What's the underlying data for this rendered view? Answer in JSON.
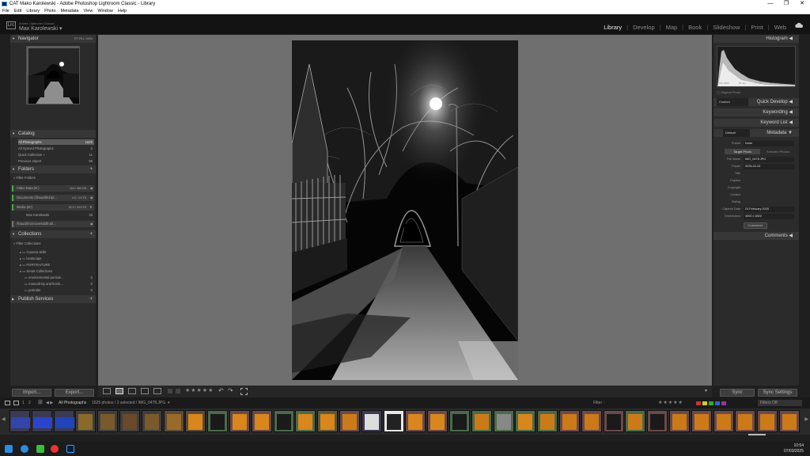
{
  "window": {
    "title": "CAT Mako Karolewski - Adobe Photoshop Lightroom Classic - Library",
    "controls": {
      "minimize": "—",
      "maximize": "❐",
      "close": "✕"
    }
  },
  "menu": [
    "File",
    "Edit",
    "Library",
    "Photo",
    "Metadata",
    "View",
    "Window",
    "Help"
  ],
  "identity": {
    "product": "Adobe Lightroom Classic",
    "user": "Max Karolewski"
  },
  "modules": [
    "Library",
    "Develop",
    "Map",
    "Book",
    "Slideshow",
    "Print",
    "Web"
  ],
  "active_module": "Library",
  "left": {
    "navigator": {
      "title": "Navigator",
      "zoom": [
        "FIT",
        "FILL",
        "100%"
      ]
    },
    "catalog": {
      "title": "Catalog",
      "items": [
        {
          "label": "All Photographs",
          "count": "1625"
        },
        {
          "label": "All Synced Photographs",
          "count": "0"
        },
        {
          "label": "Quick Collection +",
          "count": "11"
        },
        {
          "label": "Previous Import",
          "count": "89"
        }
      ]
    },
    "folders": {
      "title": "Folders",
      "filter": "Filter Folders",
      "volumes": [
        {
          "label": "Video Data (E:)",
          "info": "464 / 465 GB"
        },
        {
          "label": "Documents (\\\\hauclife1\\pr...",
          "info": "4.0 / 4.6 TB"
        },
        {
          "label": "Media (M:)",
          "info": "82.9 / 93.6 TB"
        }
      ],
      "subfolder": {
        "label": "Max Karolewski",
        "count": "25"
      },
      "extra": "\\\\hauclife1\\mcvesda\\lt-alt..."
    },
    "collections": {
      "title": "Collections",
      "filter": "Filter Collections",
      "items": [
        {
          "label": "Camera skills",
          "count": ""
        },
        {
          "label": "landscape",
          "count": ""
        },
        {
          "label": "PORTRAITURE",
          "count": ""
        },
        {
          "label": "Smart Collections",
          "count": ""
        },
        {
          "label": "environmental portrait...",
          "count": "0"
        },
        {
          "label": "masculinity and femin...",
          "count": "0"
        },
        {
          "label": "portraits",
          "count": "0"
        }
      ]
    },
    "publish": {
      "title": "Publish Services"
    },
    "import_label": "Import...",
    "export_label": "Export..."
  },
  "right": {
    "histogram": {
      "title": "Histogram",
      "readout": [
        "ISO 2500",
        "35 mm",
        "f / 1.8",
        "1/50 sec"
      ],
      "original": "Original Photo"
    },
    "quick_develop": {
      "title": "Quick Develop",
      "preset": "Custom"
    },
    "keywording": {
      "title": "Keywording"
    },
    "keyword_list": {
      "title": "Keyword List"
    },
    "metadata": {
      "title": "Metadata",
      "mode": "Default",
      "preset_label": "Preset",
      "preset_value": "None",
      "tabs": [
        "Target Photo",
        "Selected Photos"
      ],
      "fields": [
        {
          "label": "File Name",
          "value": "IMG_0478.JPG"
        },
        {
          "label": "Folder",
          "value": "2025-02-24"
        },
        {
          "label": "Title",
          "value": ""
        },
        {
          "label": "Caption",
          "value": ""
        },
        {
          "label": "Copyright",
          "value": ""
        },
        {
          "label": "Creator",
          "value": ""
        },
        {
          "label": "Rating",
          "value": ""
        },
        {
          "label": "Capture Date",
          "value": "24 February 2025"
        },
        {
          "label": "Dimensions",
          "value": "4000 x 6000"
        }
      ],
      "customize": "Customize"
    },
    "comments": {
      "title": "Comments"
    },
    "sync_label": "Sync",
    "sync_settings_label": "Sync Settings"
  },
  "toolbar": {
    "stars": "★★★★★"
  },
  "filmstrip": {
    "pages": [
      "1",
      "2"
    ],
    "source": "All Photographs",
    "status": "1625 photos / 2 selected / IMG_0478.JPG",
    "filter_label": "Filter :",
    "filter_value": "Filters Off",
    "stars": "★★★★★"
  },
  "taskbar": {
    "time": "10:54",
    "date": "07/03/2025"
  },
  "colors": {
    "accent_green": "#4aa84a",
    "selection": "#5a5a5a",
    "thumb_orange": "#d9861c"
  }
}
